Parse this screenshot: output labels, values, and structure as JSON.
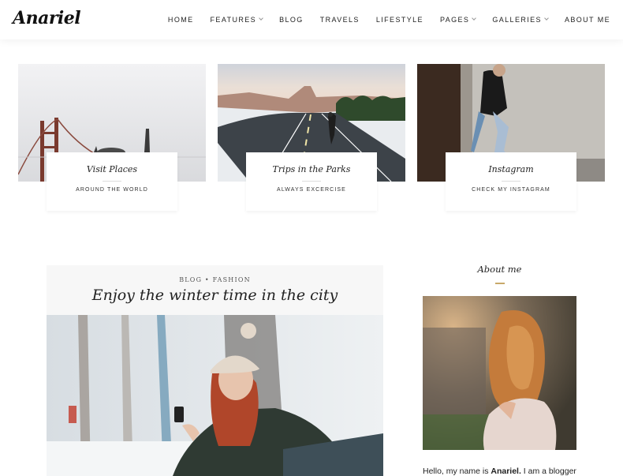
{
  "header": {
    "logo": "Anariel",
    "nav": [
      {
        "label": "HOME",
        "dropdown": false
      },
      {
        "label": "FEATURES",
        "dropdown": true
      },
      {
        "label": "BLOG",
        "dropdown": false
      },
      {
        "label": "TRAVELS",
        "dropdown": false
      },
      {
        "label": "LIFESTYLE",
        "dropdown": false
      },
      {
        "label": "PAGES",
        "dropdown": true
      },
      {
        "label": "GALLERIES",
        "dropdown": true
      },
      {
        "label": "ABOUT ME",
        "dropdown": false
      }
    ]
  },
  "features": [
    {
      "title": "Visit Places",
      "subtitle": "AROUND THE WORLD"
    },
    {
      "title": "Trips in the Parks",
      "subtitle": "ALWAYS EXCERCISE"
    },
    {
      "title": "Instagram",
      "subtitle": "CHECK MY INSTAGRAM"
    }
  ],
  "post": {
    "categories": "BLOG • FASHION",
    "title": "Enjoy the winter time in the city"
  },
  "sidebar": {
    "widget_title": "About me",
    "intro_prefix": "Hello, my name is ",
    "intro_name": "Anariel.",
    "intro_suffix": " I am a blogger"
  },
  "colors": {
    "accent": "#c8a96a",
    "header_bg": "#ffffff",
    "post_head_bg": "#f7f7f7"
  }
}
